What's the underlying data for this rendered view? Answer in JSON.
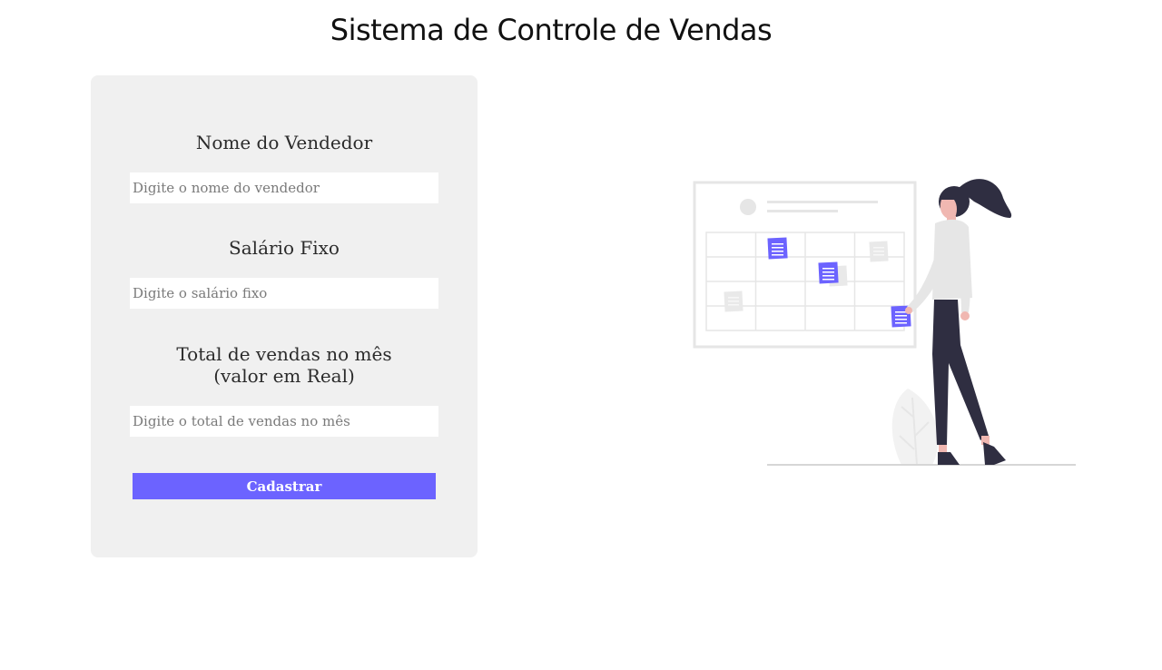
{
  "header": {
    "title": "Sistema de Controle de Vendas"
  },
  "form": {
    "seller_name": {
      "label": "Nome do Vendedor",
      "placeholder": "Digite o nome do vendedor",
      "value": ""
    },
    "fixed_salary": {
      "label": "Salário Fixo",
      "placeholder": "Digite o salário fixo",
      "value": ""
    },
    "monthly_sales": {
      "label_line1": "Total de vendas no mês",
      "label_line2": "(valor em Real)",
      "placeholder": "Digite o total de vendas no mês",
      "value": ""
    },
    "submit_label": "Cadastrar"
  },
  "illustration": {
    "icon": "woman-calendar-illustration"
  },
  "colors": {
    "accent": "#6c63ff",
    "card_background": "#f0f0f0",
    "illustration_dark": "#2f2e41"
  }
}
